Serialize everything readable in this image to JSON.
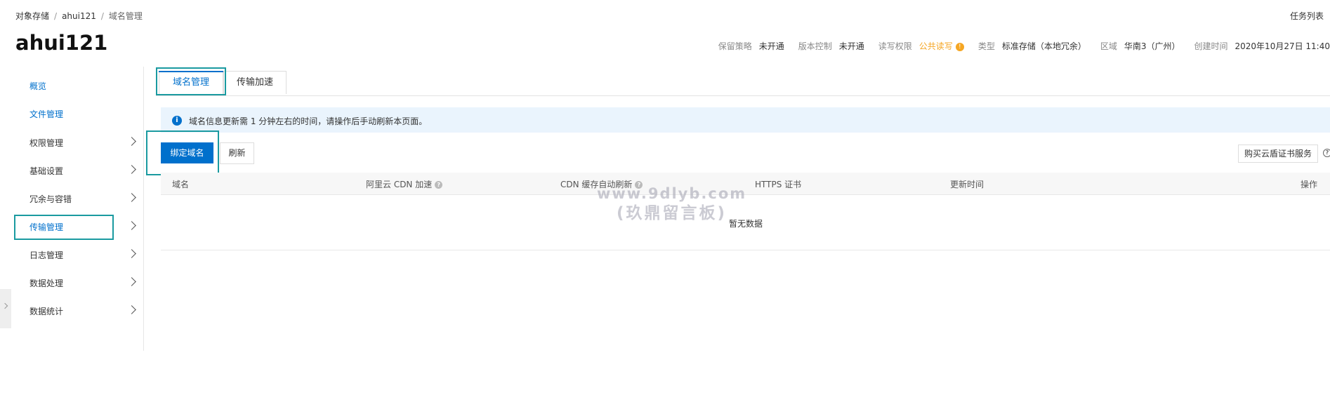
{
  "breadcrumb": [
    "对象存储",
    "ahui121",
    "域名管理"
  ],
  "header": {
    "task_list": "任务列表",
    "bucket_name": "ahui121"
  },
  "meta": {
    "retention_label": "保留策略",
    "retention_value": "未开通",
    "versioning_label": "版本控制",
    "versioning_value": "未开通",
    "acl_label": "读写权限",
    "acl_value": "公共读写",
    "acl_warn_icon": "!",
    "type_label": "类型",
    "type_value": "标准存储（本地冗余）",
    "region_label": "区域",
    "region_value": "华南3（广州）",
    "created_label": "创建时间",
    "created_value": "2020年10月27日 11:40"
  },
  "sidebar": {
    "items": [
      {
        "label": "概览"
      },
      {
        "label": "文件管理"
      },
      {
        "label": "权限管理"
      },
      {
        "label": "基础设置"
      },
      {
        "label": "冗余与容错"
      },
      {
        "label": "传输管理"
      },
      {
        "label": "日志管理"
      },
      {
        "label": "数据处理"
      },
      {
        "label": "数据统计"
      }
    ]
  },
  "tabs": [
    {
      "label": "域名管理"
    },
    {
      "label": "传输加速"
    }
  ],
  "banner": {
    "icon": "i",
    "text": "域名信息更新需 1 分钟左右的时间，请操作后手动刷新本页面。"
  },
  "toolbar": {
    "bind_label": "绑定域名",
    "refresh_label": "刷新",
    "cert_label": "购买云盾证书服务",
    "help_icon": "?"
  },
  "table": {
    "columns": [
      {
        "label": "域名"
      },
      {
        "label": "阿里云 CDN 加速"
      },
      {
        "label": "CDN 缓存自动刷新"
      },
      {
        "label": "HTTPS 证书"
      },
      {
        "label": "更新时间"
      },
      {
        "label": "操作"
      }
    ],
    "help_icon": "?",
    "empty_text": "暂无数据"
  },
  "watermark": {
    "line1": "www.9dlyb.com",
    "line2": "(玖鼎留言板)"
  },
  "colors": {
    "accent": "#0070cc",
    "highlight_box": "#1a9aa0",
    "warning": "#f5a623",
    "banner_bg": "#eaf4fd"
  }
}
